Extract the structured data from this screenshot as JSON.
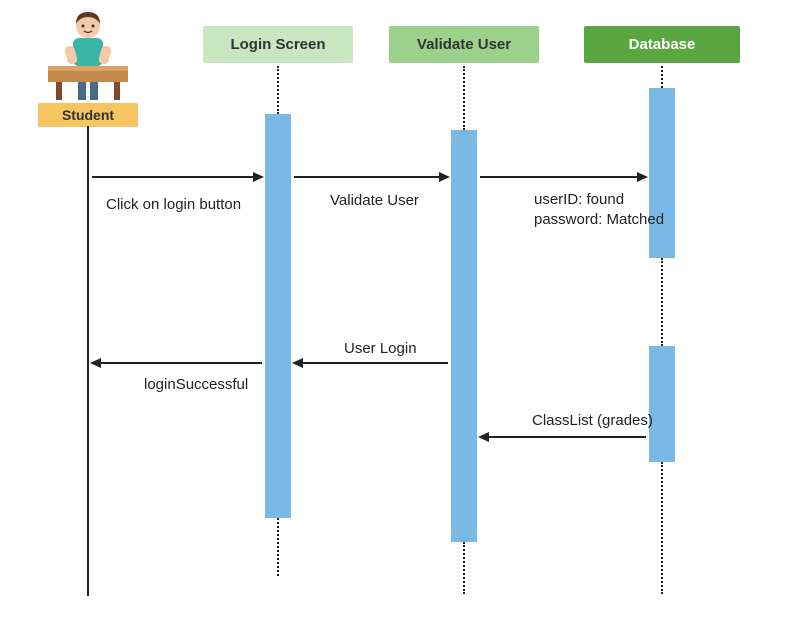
{
  "actor": {
    "name": "Student"
  },
  "participants": {
    "login": {
      "label": "Login Screen",
      "bg": "#c8e6c0"
    },
    "validate": {
      "label": "Validate User",
      "bg": "#9bd18b"
    },
    "database": {
      "label": "Database",
      "bg": "#5aa742"
    }
  },
  "messages": {
    "m1": "Click on login button",
    "m2": "Validate User",
    "m3": "userID: found\npassword: Matched",
    "m4": "User Login",
    "m5": "loginSuccessful",
    "m6": "ClassList (grades)"
  },
  "colors": {
    "activation": "#7ab8e6",
    "actorBar": "#f5c563"
  }
}
